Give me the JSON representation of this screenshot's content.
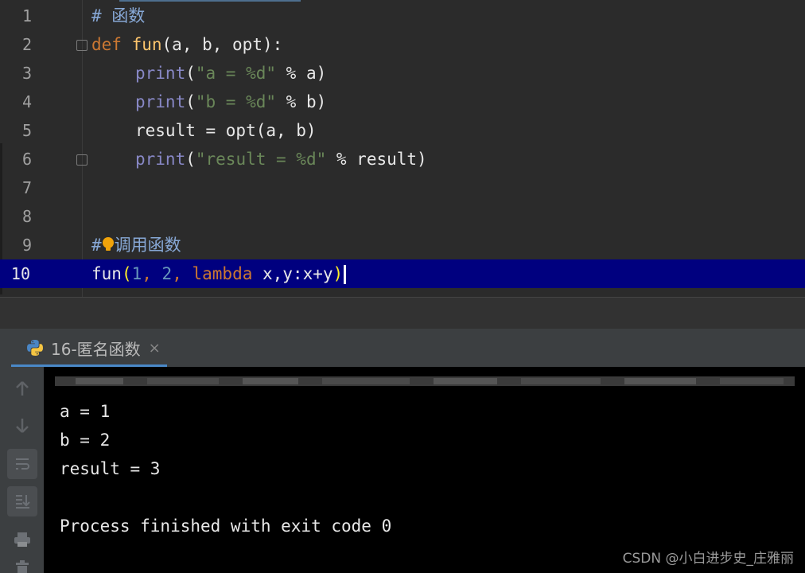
{
  "editor": {
    "lines": [
      {
        "n": "1"
      },
      {
        "n": "2"
      },
      {
        "n": "3"
      },
      {
        "n": "4"
      },
      {
        "n": "5"
      },
      {
        "n": "6"
      },
      {
        "n": "7"
      },
      {
        "n": "8"
      },
      {
        "n": "9"
      },
      {
        "n": "10"
      }
    ],
    "code": {
      "l1": "# 函数",
      "l2_def": "def",
      "l2_fn": "fun",
      "l2_rest": "(a, b, opt):",
      "l3_bi": "print",
      "l3_open": "(",
      "l3_str": "\"a = %d\"",
      "l3_rest": " % a)",
      "l4_bi": "print",
      "l4_open": "(",
      "l4_str": "\"b = %d\"",
      "l4_rest": " % b)",
      "l5": "result = opt(a, b)",
      "l6_bi": "print",
      "l6_open": "(",
      "l6_str": "\"result = %d\"",
      "l6_rest": " % result)",
      "l9_hash": "#",
      "l9_text": "调用函数",
      "l10_fn": "fun",
      "l10_open": "(",
      "l10_n1": "1",
      "l10_c1": ", ",
      "l10_n2": "2",
      "l10_c2": ", ",
      "l10_kw": "lambda",
      "l10_rest": " x,y:x+y",
      "l10_close": ")"
    }
  },
  "run_panel": {
    "tab_label": "16-匿名函数",
    "close_glyph": "×"
  },
  "console": {
    "output": [
      "a = 1",
      "b = 2",
      "result = 3",
      "",
      "Process finished with exit code 0"
    ]
  },
  "watermark": "CSDN @小白进步史_庄雅丽",
  "colors": {
    "editor_bg": "#2b2b2b",
    "current_line": "#00007f",
    "keyword": "#cc7832",
    "function": "#ffc66d",
    "builtin": "#8888c6",
    "string": "#6a8759",
    "number": "#6897bb",
    "console_bg": "#000000"
  },
  "icons": [
    "fold-marker-icon",
    "intention-bulb-icon",
    "python-icon",
    "close-icon",
    "rerun-up-icon",
    "down-arrow-icon",
    "soft-wrap-icon",
    "scroll-to-end-icon",
    "print-icon",
    "trash-icon"
  ]
}
